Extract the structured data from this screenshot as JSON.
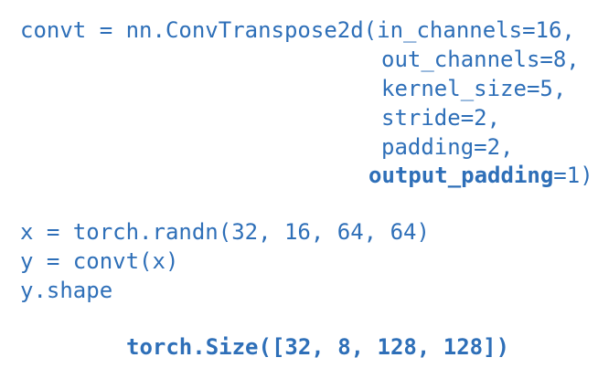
{
  "code": {
    "line1": "convt = nn.ConvTranspose2d(in_channels=16,",
    "line2": "out_channels=8,",
    "line3": "kernel_size=5,",
    "line4": "stride=2,",
    "line5": "padding=2,",
    "line6_bold": "output_padding",
    "line6_rest": "=1)",
    "line7": "x = torch.randn(32, 16, 64, 64)",
    "line8": "y = convt(x)",
    "line9": "y.shape"
  },
  "output": {
    "result": "torch.Size([32, 8, 128, 128])"
  },
  "colors": {
    "text": "#2e6fb8",
    "background": "#ffffff"
  }
}
